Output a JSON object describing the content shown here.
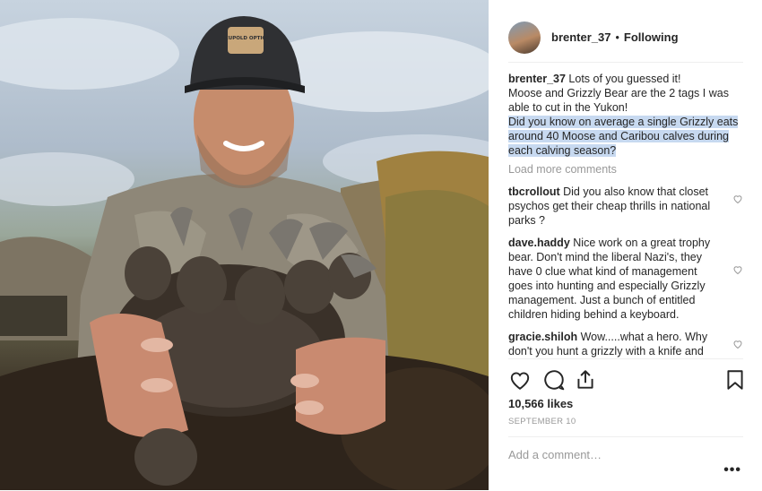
{
  "post": {
    "username": "brenter_37",
    "follow_state": "Following",
    "separator": "•",
    "caption": {
      "username": "brenter_37",
      "line1": "Lots of you guessed it!",
      "line2": "Moose and Grizzly Bear are the 2 tags I was able to cut in the Yukon!",
      "highlighted": "Did you know on average a single Grizzly eats around 40 Moose and Caribou calves during each calving season?"
    },
    "load_more": "Load more comments",
    "comments": [
      {
        "username": "tbcrollout",
        "text": "Did you also know that closet psychos get their cheap thrills in national parks ?"
      },
      {
        "username": "dave.haddy",
        "text": "Nice work on a great trophy bear. Don't mind the liberal Nazi's, they have 0 clue what kind of management goes into hunting and especially Grizzly management. Just a bunch of entitled children hiding behind a keyboard."
      },
      {
        "username": "gracie.shiloh",
        "text": "Wow.....what a hero. Why don't you hunt a grizzly with a knife and see how you do then?"
      }
    ],
    "likes": "10,566 likes",
    "date": "SEPTEMBER 10",
    "add_comment_placeholder": "Add a comment…",
    "more_options": "•••"
  },
  "photo": {
    "cap_text": "LEUPOLD OPTICS"
  },
  "icons": {
    "like": "heart-icon",
    "comment": "comment-icon",
    "share": "share-icon",
    "save": "bookmark-icon"
  }
}
